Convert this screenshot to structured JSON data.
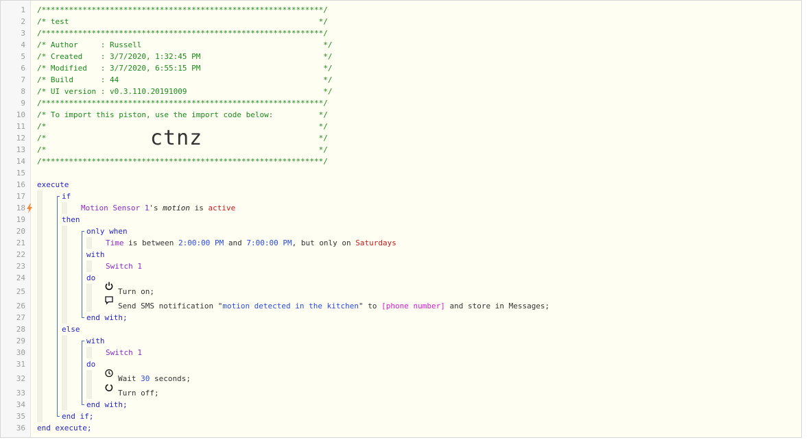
{
  "lines": [
    {
      "n": "1",
      "segs": [
        {
          "t": "/**************************************************************/",
          "c": "cm"
        }
      ]
    },
    {
      "n": "2",
      "segs": [
        {
          "t": "/* test                                                       */",
          "c": "cm"
        }
      ]
    },
    {
      "n": "3",
      "segs": [
        {
          "t": "/**************************************************************/",
          "c": "cm"
        }
      ]
    },
    {
      "n": "4",
      "segs": [
        {
          "t": "/* Author     : Russell                                        */",
          "c": "cm"
        }
      ]
    },
    {
      "n": "5",
      "segs": [
        {
          "t": "/* Created    : 3/7/2020, 1:32:45 PM                           */",
          "c": "cm"
        }
      ]
    },
    {
      "n": "6",
      "segs": [
        {
          "t": "/* Modified   : 3/7/2020, 6:55:15 PM                           */",
          "c": "cm"
        }
      ]
    },
    {
      "n": "7",
      "segs": [
        {
          "t": "/* Build      : 44                                             */",
          "c": "cm"
        }
      ]
    },
    {
      "n": "8",
      "segs": [
        {
          "t": "/* UI version : v0.3.110.20191009                              */",
          "c": "cm"
        }
      ]
    },
    {
      "n": "9",
      "segs": [
        {
          "t": "/**************************************************************/",
          "c": "cm"
        }
      ]
    },
    {
      "n": "10",
      "segs": [
        {
          "t": "/* To import this piston, use the import code below:          */",
          "c": "cm"
        }
      ]
    },
    {
      "n": "11",
      "segs": [
        {
          "t": "/*                                                            */",
          "c": "cm"
        }
      ]
    },
    {
      "n": "12",
      "segs": [
        {
          "t": "/*                                                            */",
          "c": "cm"
        }
      ]
    },
    {
      "n": "13",
      "segs": [
        {
          "t": "/*                                                            */",
          "c": "cm"
        }
      ]
    },
    {
      "n": "14",
      "segs": [
        {
          "t": "/**************************************************************/",
          "c": "cm"
        }
      ]
    },
    {
      "n": "15",
      "segs": []
    },
    {
      "n": "16",
      "segs": [
        {
          "t": "execute",
          "c": "kw"
        }
      ]
    },
    {
      "n": "17",
      "segs": [
        {
          "t": "if",
          "c": "kw"
        }
      ]
    },
    {
      "n": "18",
      "segs": [
        {
          "t": "Motion Sensor 1",
          "c": "dev"
        },
        {
          "t": "'s ",
          "c": "pl"
        },
        {
          "t": "motion",
          "c": "attr"
        },
        {
          "t": " is ",
          "c": "pl"
        },
        {
          "t": "active",
          "c": "val"
        }
      ]
    },
    {
      "n": "19",
      "segs": [
        {
          "t": "then",
          "c": "kw"
        }
      ]
    },
    {
      "n": "20",
      "segs": [
        {
          "t": "only when",
          "c": "kw"
        }
      ]
    },
    {
      "n": "21",
      "segs": [
        {
          "t": "Time",
          "c": "dev"
        },
        {
          "t": " is between ",
          "c": "pl"
        },
        {
          "t": "2:00:00 PM",
          "c": "num"
        },
        {
          "t": " and ",
          "c": "pl"
        },
        {
          "t": "7:00:00 PM",
          "c": "num"
        },
        {
          "t": ", but only on ",
          "c": "pl"
        },
        {
          "t": "Saturdays",
          "c": "val"
        }
      ]
    },
    {
      "n": "22",
      "segs": [
        {
          "t": "with",
          "c": "kw"
        }
      ]
    },
    {
      "n": "23",
      "segs": [
        {
          "t": "Switch 1",
          "c": "dev"
        }
      ]
    },
    {
      "n": "24",
      "segs": [
        {
          "t": "do",
          "c": "kw"
        }
      ]
    },
    {
      "n": "25",
      "segs": [
        {
          "t": "Turn on;",
          "c": "pl"
        }
      ]
    },
    {
      "n": "26",
      "segs": [
        {
          "t": "Send SMS notification \"",
          "c": "pl"
        },
        {
          "t": "motion detected in the kitchen",
          "c": "str"
        },
        {
          "t": "\" to ",
          "c": "pl"
        },
        {
          "t": "[phone number]",
          "c": "var"
        },
        {
          "t": " and store in Messages;",
          "c": "pl"
        }
      ]
    },
    {
      "n": "27",
      "segs": [
        {
          "t": "end with;",
          "c": "kw"
        }
      ]
    },
    {
      "n": "28",
      "segs": [
        {
          "t": "else",
          "c": "kw"
        }
      ]
    },
    {
      "n": "29",
      "segs": [
        {
          "t": "with",
          "c": "kw"
        }
      ]
    },
    {
      "n": "30",
      "segs": [
        {
          "t": "Switch 1",
          "c": "dev"
        }
      ]
    },
    {
      "n": "31",
      "segs": [
        {
          "t": "do",
          "c": "kw"
        }
      ]
    },
    {
      "n": "32",
      "segs": [
        {
          "t": "Wait ",
          "c": "pl"
        },
        {
          "t": "30",
          "c": "num"
        },
        {
          "t": " seconds;",
          "c": "pl"
        }
      ]
    },
    {
      "n": "33",
      "segs": [
        {
          "t": "Turn off;",
          "c": "pl"
        }
      ]
    },
    {
      "n": "34",
      "segs": [
        {
          "t": "end with;",
          "c": "kw"
        }
      ]
    },
    {
      "n": "35",
      "segs": [
        {
          "t": "end if;",
          "c": "kw"
        }
      ]
    },
    {
      "n": "36",
      "segs": [
        {
          "t": "end execute;",
          "c": "kw"
        }
      ]
    }
  ],
  "import_code": "ctnz",
  "line_icons": {
    "18": "bolt-icon",
    "25": "power-on-icon",
    "26": "message-icon",
    "32": "clock-icon",
    "33": "power-off-icon"
  },
  "colors": {
    "comment": "#1a8a1a",
    "keyword": "#1f1fc8",
    "device": "#8a2ac8",
    "value": "#c81a1a",
    "number": "#2a4ae0",
    "variable": "#d81ad8",
    "bracket": "#3a6fd8",
    "bolt": "#f08a3a"
  }
}
